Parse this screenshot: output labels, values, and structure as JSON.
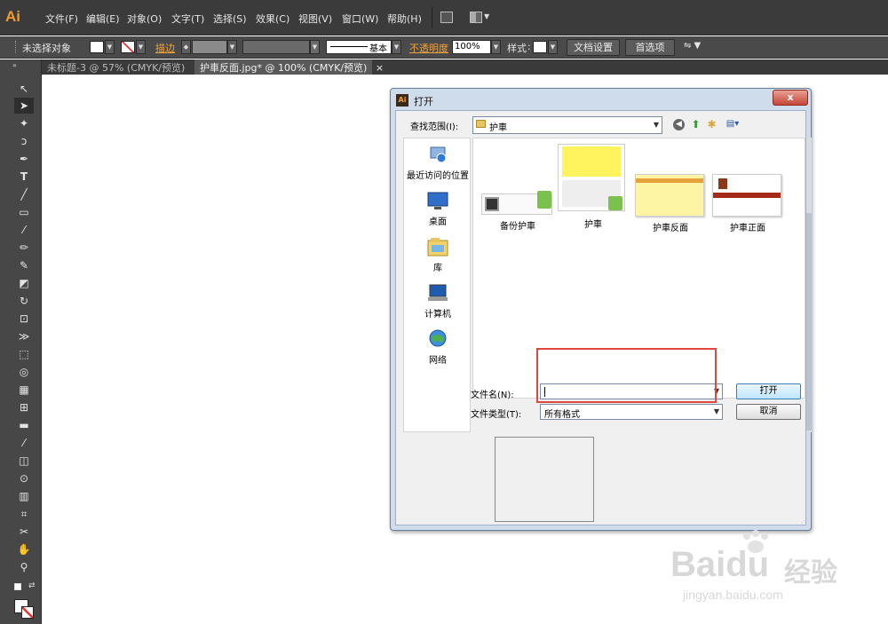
{
  "app": {
    "logo": "Ai"
  },
  "menu": [
    "文件(F)",
    "编辑(E)",
    "对象(O)",
    "文字(T)",
    "选择(S)",
    "效果(C)",
    "视图(V)",
    "窗口(W)",
    "帮助(H)"
  ],
  "control_bar": {
    "selection_status": "未选择对象",
    "stroke_label": "描边",
    "brush_preset": "基本",
    "opacity_label": "不透明度",
    "opacity_value": "100%",
    "style_label": "样式",
    "doc_setup_button": "文档设置",
    "prefs_button": "首选项"
  },
  "tabs": [
    {
      "label": "未标题-3 @ 57% (CMYK/预览)",
      "close": "×",
      "active": false
    },
    {
      "label": "护車反面.jpg* @ 100% (CMYK/预览)",
      "close": "×",
      "active": true
    }
  ],
  "dialog": {
    "title": "打开",
    "close": "x",
    "look_in_label": "查找范围(I):",
    "look_in_value": "护車",
    "places": [
      {
        "label": "最近访问的位置",
        "icon": "recent-places-icon"
      },
      {
        "label": "桌面",
        "icon": "desktop-icon"
      },
      {
        "label": "库",
        "icon": "library-icon"
      },
      {
        "label": "计算机",
        "icon": "computer-icon"
      },
      {
        "label": "网络",
        "icon": "network-icon"
      }
    ],
    "files": [
      {
        "label": "备份护車",
        "type": "folder"
      },
      {
        "label": "护車",
        "type": "folder"
      },
      {
        "label": "护車反面",
        "type": "image"
      },
      {
        "label": "护車正面",
        "type": "image"
      }
    ],
    "filename_label": "文件名(N):",
    "filename_value": "",
    "filetype_label": "文件类型(T):",
    "filetype_value": "所有格式",
    "open_button": "打开",
    "cancel_button": "取消"
  },
  "watermark": {
    "brand": "Baidu",
    "brand_cn": "经验",
    "url": "jingyan.baidu.com"
  },
  "colors": {
    "accent_red": "#e0483f",
    "ai_orange": "#f29a2e",
    "app_bg": "#3b3b3b"
  }
}
